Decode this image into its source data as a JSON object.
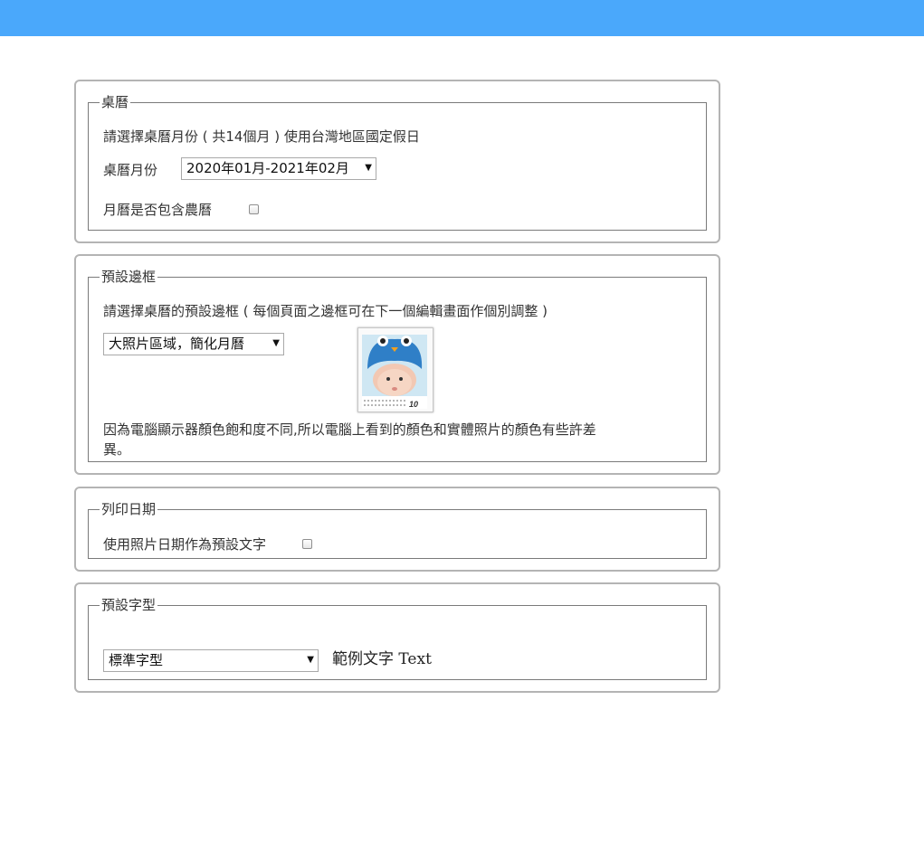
{
  "calendar": {
    "legend": "桌曆",
    "description": "請選擇桌曆月份 ( 共14個月 ) 使用台灣地區國定假日",
    "month_label": "桌曆月份",
    "month_value": "2020年01月-2021年02月",
    "lunar_label": "月曆是否包含農曆"
  },
  "frame": {
    "legend": "預設邊框",
    "description": "請選擇桌曆的預設邊框 ( 每個頁面之邊框可在下一個編輯畫面作個別調整 )",
    "frame_value": "大照片區域，簡化月曆",
    "preview_month": "10",
    "note_line1": "因為電腦顯示器顏色飽和度不同,所以電腦上看到的顏色和實體照片的顏色有些許差",
    "note_line2": "異。"
  },
  "print_date": {
    "legend": "列印日期",
    "label": "使用照片日期作為預設文字"
  },
  "font": {
    "legend": "預設字型",
    "font_value": "標準字型",
    "sample_text": "範例文字 Text"
  },
  "colors": {
    "topbar": "#4aa8fb",
    "panel_border": "#b4b4b4"
  }
}
